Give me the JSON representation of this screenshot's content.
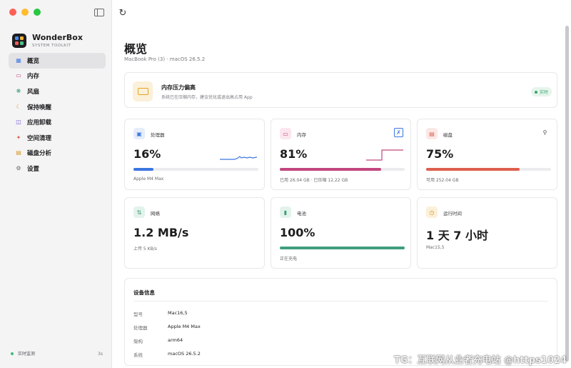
{
  "app": {
    "name": "WonderBox",
    "subtitle": "SYSTEM TOOLKIT"
  },
  "sidebar": {
    "items": [
      {
        "label": "概览",
        "icon": "grid-icon"
      },
      {
        "label": "内存",
        "icon": "memory-icon"
      },
      {
        "label": "风扇",
        "icon": "fan-icon"
      },
      {
        "label": "保持唤醒",
        "icon": "moon-icon"
      },
      {
        "label": "应用卸载",
        "icon": "box-icon"
      },
      {
        "label": "空间清理",
        "icon": "sparkle-icon"
      },
      {
        "label": "磁盘分析",
        "icon": "disk-icon"
      },
      {
        "label": "设置",
        "icon": "gear-icon"
      }
    ],
    "live_label": "实时监测",
    "live_interval": "3s"
  },
  "header": {
    "title": "概览",
    "subtitle": "MacBook Pro (3) · macOS 26.5.2"
  },
  "alert": {
    "title": "内存压力偏高",
    "description": "系统已在压缩内存，建议优化或退出高占用 App",
    "badge": "实时"
  },
  "stats": {
    "cpu": {
      "label": "处理器",
      "value": "16%",
      "progress": 0.16,
      "note": "Apple M4 Max",
      "color": "#3b76e1"
    },
    "memory": {
      "label": "内存",
      "value": "81%",
      "progress": 0.81,
      "note": "已用 26.04 GB · 已压缩 12.22 GB",
      "color": "#c2477f"
    },
    "disk": {
      "label": "磁盘",
      "value": "75%",
      "progress": 0.75,
      "note": "可用 252.04 GB",
      "color": "#dd5f4d"
    },
    "network": {
      "label": "网络",
      "value": "1.2 MB/s",
      "note": "上传 5 KB/s"
    },
    "battery": {
      "label": "电池",
      "value": "100%",
      "progress": 1.0,
      "note": "正在充电",
      "color": "#3f9e7c"
    },
    "uptime": {
      "label": "运行时间",
      "value": "1 天 7 小时",
      "note": "Mac15,5"
    }
  },
  "device": {
    "title": "设备信息",
    "rows": [
      {
        "key": "型号",
        "value": "Mac16,5"
      },
      {
        "key": "处理器",
        "value": "Apple M4 Max"
      },
      {
        "key": "架构",
        "value": "arm64"
      },
      {
        "key": "系统",
        "value": "macOS 26.5.2"
      }
    ]
  },
  "watermark": "TG：互联网从业者充电站 @https1024"
}
